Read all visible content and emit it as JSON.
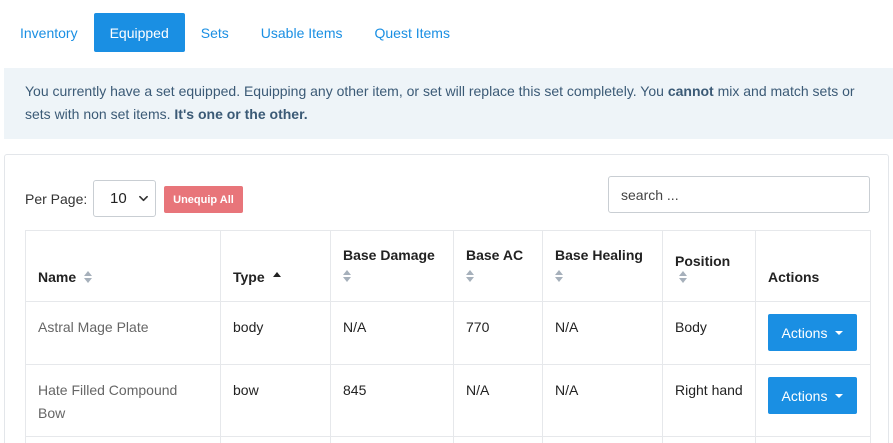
{
  "tabs": [
    {
      "label": "Inventory",
      "active": false
    },
    {
      "label": "Equipped",
      "active": true
    },
    {
      "label": "Sets",
      "active": false
    },
    {
      "label": "Usable Items",
      "active": false
    },
    {
      "label": "Quest Items",
      "active": false
    }
  ],
  "alert": {
    "text1": "You currently have a set equipped. Equipping any other item, or set will replace this set completely. You ",
    "bold1": "cannot",
    "text2": " mix and match sets or sets with non set items. ",
    "bold2": "It's one or the other."
  },
  "controls": {
    "per_page_label": "Per Page:",
    "per_page_value": "10",
    "unequip_label": "Unequip All",
    "search_placeholder": "search ..."
  },
  "table": {
    "headers": {
      "name": "Name",
      "type": "Type",
      "base_damage": "Base Damage",
      "base_ac": "Base AC",
      "base_healing": "Base Healing",
      "position": "Position",
      "actions": "Actions"
    },
    "rows": [
      {
        "name": "Astral Mage Plate",
        "type": "body",
        "base_damage": "N/A",
        "base_ac": "770",
        "base_healing": "N/A",
        "position": "Body",
        "action": "Actions"
      },
      {
        "name": "Hate Filled Compound Bow",
        "type": "bow",
        "base_damage": "845",
        "base_ac": "N/A",
        "base_healing": "N/A",
        "position": "Right hand",
        "action": "Actions"
      }
    ]
  },
  "colors": {
    "accent": "#1a8fe3",
    "danger": "#e8757a",
    "alert_bg": "#eef4f8",
    "alert_text": "#3b5a76"
  }
}
